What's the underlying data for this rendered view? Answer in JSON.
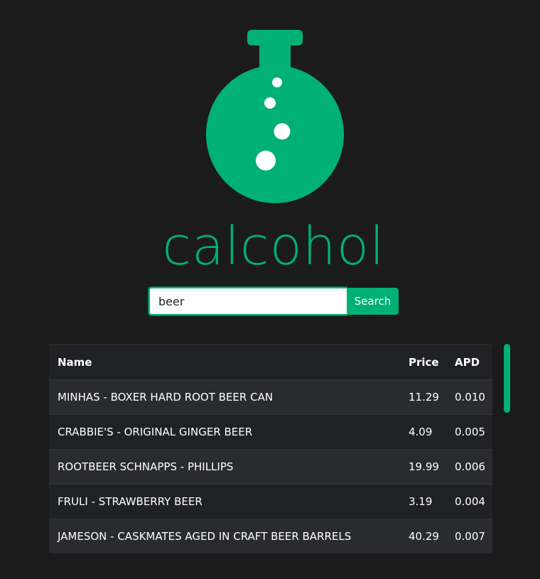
{
  "brand": {
    "name": "calcohol",
    "accent_color": "#00b074",
    "logo_icon": "flask-icon"
  },
  "search": {
    "value": "beer",
    "button_label": "Search"
  },
  "table": {
    "headers": [
      "Name",
      "Price",
      "APD"
    ],
    "rows": [
      {
        "name": "MINHAS - BOXER HARD ROOT BEER CAN",
        "price": "11.29",
        "apd": "0.010"
      },
      {
        "name": "CRABBIE'S - ORIGINAL GINGER BEER",
        "price": "4.09",
        "apd": "0.005"
      },
      {
        "name": "ROOTBEER SCHNAPPS - PHILLIPS",
        "price": "19.99",
        "apd": "0.006"
      },
      {
        "name": "FRULI - STRAWBERRY BEER",
        "price": "3.19",
        "apd": "0.004"
      },
      {
        "name": "JAMESON - CASKMATES AGED IN CRAFT BEER BARRELS",
        "price": "40.29",
        "apd": "0.007"
      }
    ]
  }
}
